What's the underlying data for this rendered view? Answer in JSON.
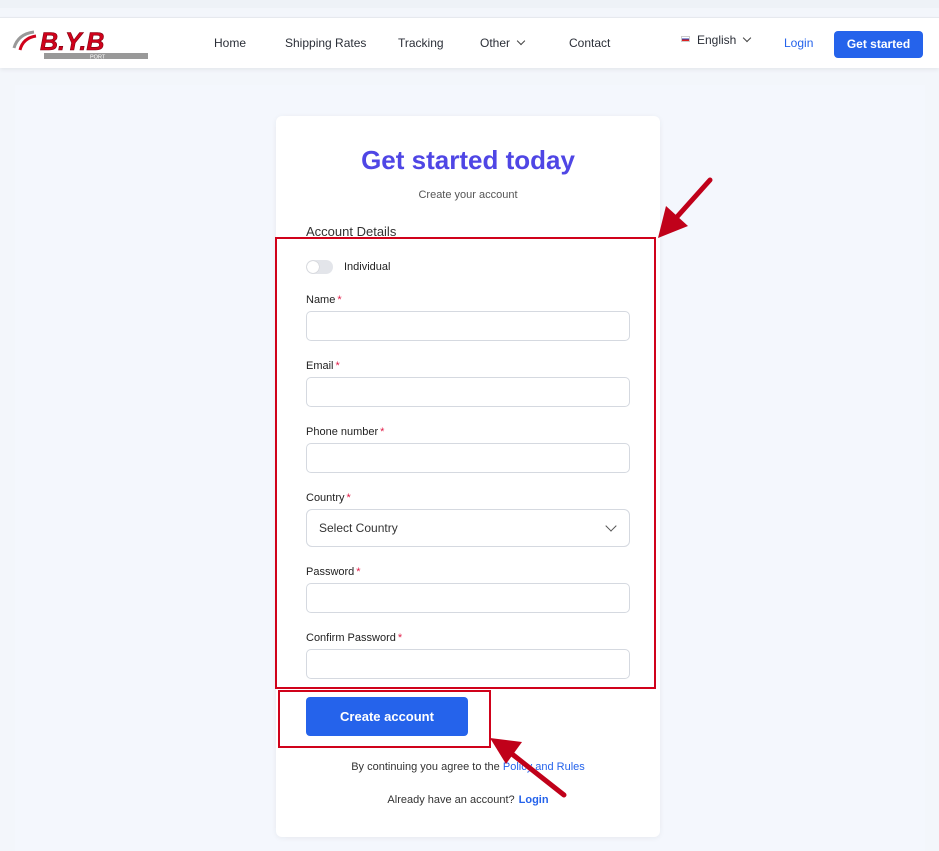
{
  "header": {
    "logo_text": "B.Y.B",
    "logo_sub": "PORT",
    "nav": [
      "Home",
      "Shipping Rates",
      "Tracking",
      "Other",
      "Contact"
    ],
    "language": "English",
    "login": "Login",
    "get_started": "Get started"
  },
  "form": {
    "title": "Get started today",
    "subtitle": "Create your account",
    "section": "Account Details",
    "toggle_label": "Individual",
    "fields": {
      "name": "Name",
      "email": "Email",
      "phone": "Phone number",
      "country": "Country",
      "password": "Password",
      "confirm_password": "Confirm Password"
    },
    "required_mark": "*",
    "country_placeholder": "Select Country",
    "submit": "Create account",
    "agree_text": "By continuing you agree to the",
    "agree_link": "Policy and Rules",
    "already_text": "Already have an account?",
    "already_link": "Login"
  },
  "colors": {
    "accent": "#2563eb",
    "title": "#4f46e5",
    "annotation": "#d0021b"
  }
}
